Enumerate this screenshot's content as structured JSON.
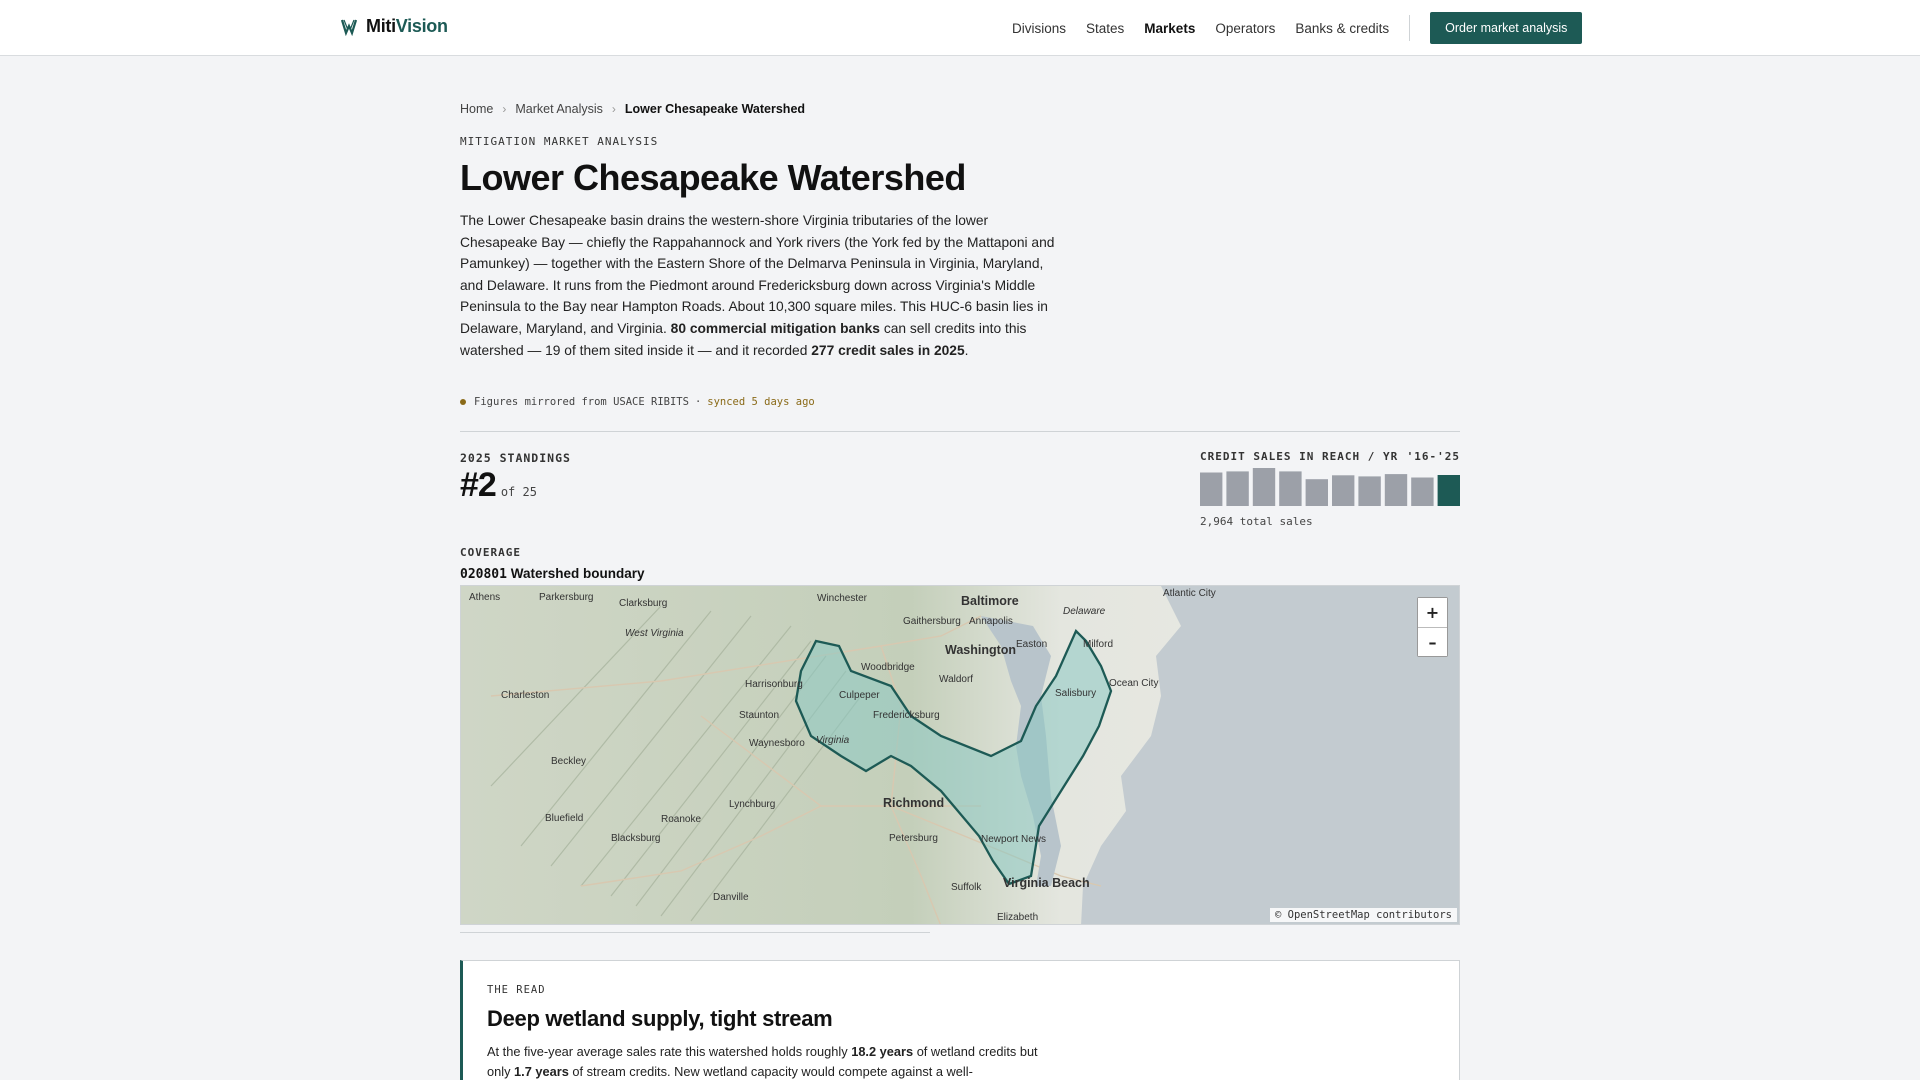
{
  "brand": {
    "name_a": "Miti",
    "name_b": "Vision"
  },
  "nav": {
    "items": [
      "Divisions",
      "States",
      "Markets",
      "Operators",
      "Banks & credits"
    ],
    "active": "Markets",
    "cta": "Order market analysis"
  },
  "breadcrumb": {
    "home": "Home",
    "section": "Market Analysis",
    "current": "Lower Chesapeake Watershed"
  },
  "page": {
    "eyebrow": "MITIGATION MARKET ANALYSIS",
    "title": "Lower Chesapeake Watershed",
    "desc_1": "The Lower Chesapeake basin drains the western-shore Virginia tributaries of the lower Chesapeake Bay — chiefly the Rappahannock and York rivers (the York fed by the Mattaponi and Pamunkey) — together with the Eastern Shore of the Delmarva Peninsula in Virginia, Maryland, and Delaware. It runs from the Piedmont around Fredericksburg down across Virginia's Middle Peninsula to the Bay near Hampton Roads. About 10,300 square miles. This HUC-6 basin lies in Delaware, Maryland, and Virginia.",
    "desc_banks": "80 commercial mitigation banks",
    "desc_2": "can sell credits into this watershed — 19 of them sited inside it — and it recorded",
    "desc_sales": "277 credit sales in 2025",
    "desc_end": ".",
    "source": "Figures mirrored from USACE RIBITS",
    "source_sep": "·",
    "synced": "synced 5 days ago"
  },
  "standings": {
    "label": "2025 STANDINGS",
    "rank": "#2",
    "of": "of 25"
  },
  "chart_data": {
    "type": "bar",
    "title": "CREDIT SALES IN REACH / YR",
    "range_label": "'16-'25",
    "categories": [
      "2016",
      "2017",
      "2018",
      "2019",
      "2020",
      "2021",
      "2022",
      "2023",
      "2024",
      "2025"
    ],
    "values": [
      300,
      310,
      340,
      310,
      240,
      275,
      265,
      285,
      255,
      277
    ],
    "ylim": [
      0,
      340
    ],
    "highlight_index": 9,
    "colors": {
      "bar": "#9ca0a8",
      "highlight": "#1d5a55"
    },
    "total_label": "2,964 total sales"
  },
  "coverage": {
    "label": "COVERAGE",
    "code": "020801",
    "name": "Watershed boundary"
  },
  "map": {
    "zoom_in": "+",
    "zoom_out": "–",
    "attribution": "© OpenStreetMap contributors",
    "labels": [
      "Athens",
      "Parkersburg",
      "Clarksburg",
      "West Virginia",
      "Winchester",
      "Baltimore",
      "Delaware",
      "Atlantic City",
      "Gaithersburg",
      "Annapolis",
      "Washington",
      "Easton",
      "Milford",
      "Woodbridge",
      "Waldorf",
      "Harrisonburg",
      "Culpeper",
      "Fredericksburg",
      "Salisbury",
      "Ocean City",
      "Charleston",
      "Staunton",
      "Waynesboro",
      "Virginia",
      "Beckley",
      "Richmond",
      "Lynchburg",
      "Roanoke",
      "Bluefield",
      "Blacksburg",
      "Petersburg",
      "Newport News",
      "Virginia Beach",
      "Suffolk",
      "Danville",
      "Elizabeth"
    ]
  },
  "read": {
    "label": "THE READ",
    "title": "Deep wetland supply, tight stream",
    "body_1": "At the five-year average sales rate this watershed holds roughly",
    "wet_years": "18.2 years",
    "body_2": "of wetland credits but only",
    "stream_years": "1.7 years",
    "body_3": "of stream credits. New wetland capacity would compete against a well-"
  }
}
